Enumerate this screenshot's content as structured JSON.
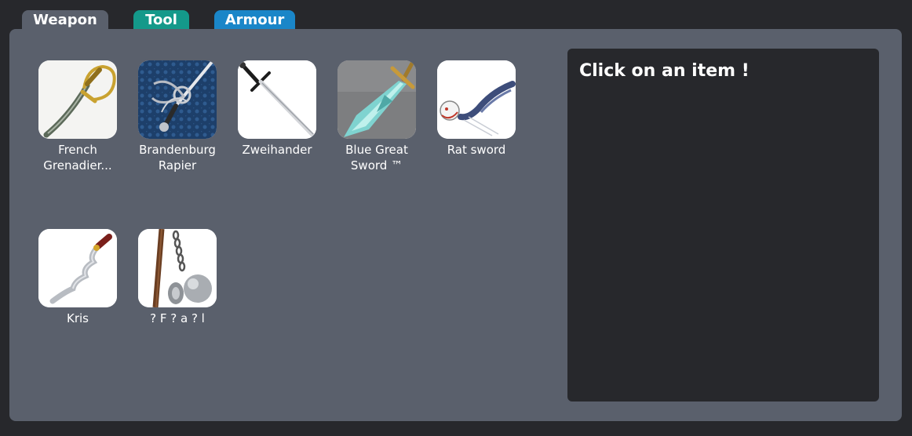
{
  "tabs": {
    "weapon": "Weapon",
    "tool": "Tool",
    "armour": "Armour"
  },
  "colors": {
    "background": "#27282c",
    "panel": "#5a606c",
    "tab_tool": "#14998a",
    "tab_armour": "#1a86c8"
  },
  "items": [
    {
      "label": "French Grenadier...",
      "icon": "sabre-icon"
    },
    {
      "label": "Brandenburg Rapier",
      "icon": "rapier-icon"
    },
    {
      "label": "Zweihander",
      "icon": "greatsword-icon"
    },
    {
      "label": "Blue Great Sword ™",
      "icon": "blue-sword-icon"
    },
    {
      "label": "Rat sword",
      "icon": "rat-sword-icon"
    },
    {
      "label": "Kris",
      "icon": "kris-icon"
    },
    {
      "label": "? F ? a ? l",
      "icon": "flail-icon"
    }
  ],
  "detail": {
    "prompt": "Click on an item !"
  }
}
